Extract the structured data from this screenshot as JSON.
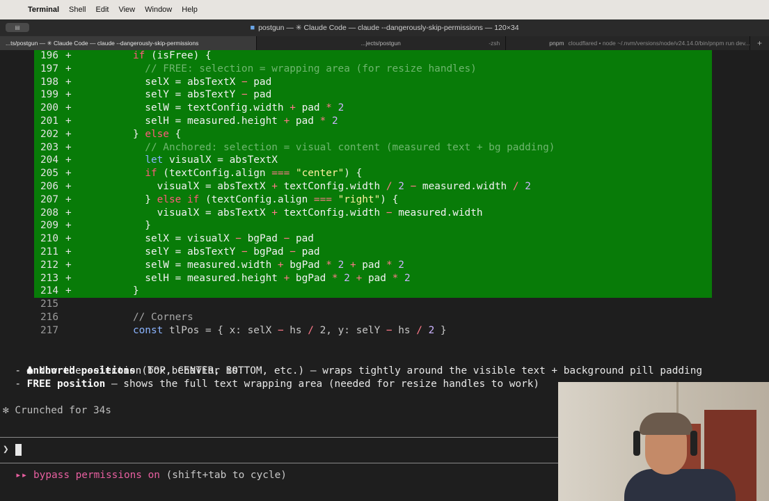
{
  "menubar": {
    "app": "Terminal",
    "items": [
      "Shell",
      "Edit",
      "View",
      "Window",
      "Help"
    ]
  },
  "window": {
    "title": "postgun — ✳ Claude Code — claude --dangerously-skip-permissions — 120×34"
  },
  "tabs": [
    {
      "label": "...ts/postgun — ✳ Claude Code — claude --dangerously-skip-permissions",
      "active": true
    },
    {
      "label": "...jects/postgun",
      "extra": "-zsh"
    },
    {
      "label": "pnpm",
      "extra": "cloudflared • node ~/.nvm/versions/node/v24.14.0/bin/pnpm run dev..."
    }
  ],
  "diff_lines": [
    {
      "n": "196",
      "mark": "+",
      "code": "      if (isFree) {"
    },
    {
      "n": "197",
      "mark": "+",
      "code": "        // FREE: selection = wrapping area (for resize handles)"
    },
    {
      "n": "198",
      "mark": "+",
      "code": "        selX = absTextX − pad"
    },
    {
      "n": "199",
      "mark": "+",
      "code": "        selY = absTextY − pad"
    },
    {
      "n": "200",
      "mark": "+",
      "code": "        selW = textConfig.width + pad * 2"
    },
    {
      "n": "201",
      "mark": "+",
      "code": "        selH = measured.height + pad * 2"
    },
    {
      "n": "202",
      "mark": "+",
      "code": "      } else {"
    },
    {
      "n": "203",
      "mark": "+",
      "code": "        // Anchored: selection = visual content (measured text + bg padding)"
    },
    {
      "n": "204",
      "mark": "+",
      "code": "        let visualX = absTextX"
    },
    {
      "n": "205",
      "mark": "+",
      "code": "        if (textConfig.align === \"center\") {"
    },
    {
      "n": "206",
      "mark": "+",
      "code": "          visualX = absTextX + textConfig.width / 2 − measured.width / 2"
    },
    {
      "n": "207",
      "mark": "+",
      "code": "        } else if (textConfig.align === \"right\") {"
    },
    {
      "n": "208",
      "mark": "+",
      "code": "          visualX = absTextX + textConfig.width − measured.width"
    },
    {
      "n": "209",
      "mark": "+",
      "code": "        }"
    },
    {
      "n": "210",
      "mark": "+",
      "code": "        selX = visualX − bgPad − pad"
    },
    {
      "n": "211",
      "mark": "+",
      "code": "        selY = absTextY − bgPad − pad"
    },
    {
      "n": "212",
      "mark": "+",
      "code": "        selW = measured.width + bgPad * 2 + pad * 2"
    },
    {
      "n": "213",
      "mark": "+",
      "code": "        selH = measured.height + bgPad * 2 + pad * 2"
    },
    {
      "n": "214",
      "mark": "+",
      "code": "      }"
    }
  ],
  "context_lines": [
    {
      "n": "215",
      "code": ""
    },
    {
      "n": "216",
      "code": "      // Corners"
    },
    {
      "n": "217",
      "code": "      const tlPos = { x: selX − hs / 2, y: selY − hs / 2 }"
    }
  ],
  "message": {
    "bullet": "●",
    "intro": "Now the selection box behavior is:",
    "item1_bold": "Anchored positions",
    "item1_rest": " (TOP, CENTER, BOTTOM, etc.) — wraps tightly around the visible text + background pill padding",
    "item2_bold": "FREE position",
    "item2_rest": " — shows the full text wrapping area (needed for resize handles to work)"
  },
  "status": {
    "crunched": "✻ Crunched for 34s"
  },
  "prompt": {
    "symbol": "❯"
  },
  "footer": {
    "arrows": "▸▸",
    "bypass": "bypass permissions on",
    "hint": " (shift+tab to cycle)"
  },
  "colors": {
    "diff_bg": "#087b08",
    "terminal_bg": "#1e1e1e",
    "keyword": "#ff5c7c",
    "bypass": "#e85fa0"
  }
}
